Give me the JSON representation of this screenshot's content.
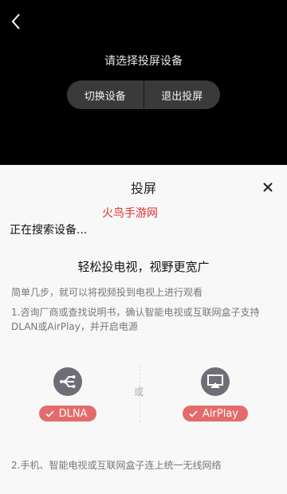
{
  "cast_panel": {
    "prompt": "请选择投屏设备",
    "switch_device": "切换设备",
    "exit_cast": "退出投屏"
  },
  "sheet": {
    "title": "投屏",
    "watermark": "火鸟手游网",
    "searching": "正在搜索设备...",
    "headline": "轻松投电视，视野更宽广",
    "subline": "简单几步，就可以将视频投到电视上进行观看",
    "step1": "1.咨询厂商或查找说明书，确认智能电视或互联网盒子支持DLAN或AirPlay，并开启电源",
    "or": "或",
    "dlna_label": "DLNA",
    "airplay_label": "AirPlay",
    "step2": "2.手机、智能电视或互联网盒子连上统一无线网络"
  },
  "icons": {
    "back": "chevron-left-icon",
    "close": "close-icon",
    "dlna": "dlna-icon",
    "airplay": "airplay-icon",
    "check": "check-icon"
  },
  "colors": {
    "top_bg": "#000000",
    "sheet_bg": "#f8f8f8",
    "badge": "#e46b6b",
    "icon_circle": "#6e6e76",
    "watermark": "#e0312f"
  }
}
